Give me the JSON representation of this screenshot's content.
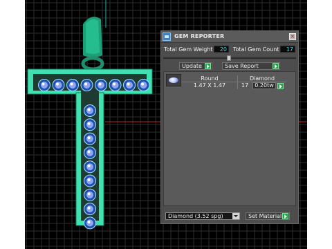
{
  "panel": {
    "title": "GEM REPORTER",
    "total_weight_label": "Total Gem Weight",
    "total_weight_value": "20",
    "total_count_label": "Total Gem Count",
    "total_count_value": "17",
    "update_label": "Update",
    "save_label": "Save Report",
    "table": {
      "headers": [
        "Round",
        "Diamond"
      ],
      "rows": [
        {
          "size": "1.47 X 1.47",
          "count": "17",
          "weight": "0.20tw"
        }
      ]
    },
    "material_select": "Diamond    (3.52 spg)",
    "set_material_label": "Set Material"
  },
  "colors": {
    "gold_model": "#3ee0b0",
    "gem": "#6f86d6",
    "grid": "#2e2e2e",
    "value_text": "#48d9e8",
    "play_button": "#22a34a"
  }
}
